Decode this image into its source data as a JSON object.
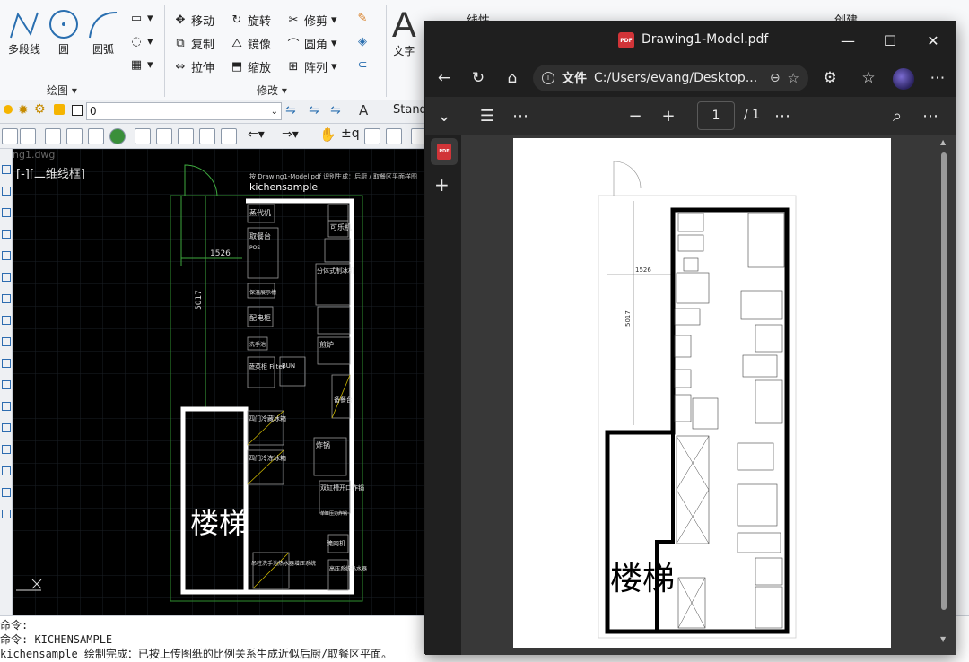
{
  "cad": {
    "ribbon": {
      "draw": {
        "polyline_label": "多段线",
        "circle_label": "圆",
        "arc_label": "圆弧",
        "group_label": "绘图 ▾"
      },
      "modify": {
        "move_label": "移动",
        "rotate_label": "旋转",
        "trim_label": "修剪",
        "copy_label": "复制",
        "mirror_label": "镜像",
        "fillet_label": "圆角",
        "stretch_label": "拉伸",
        "scale_label": "缩放",
        "array_label": "阵列",
        "group_label": "修改 ▾"
      },
      "annotation": {
        "text_label": "文字"
      },
      "partial_right": {
        "linear_label": "线性",
        "create_label": "创建"
      }
    },
    "layer_bar": {
      "layer_value": "0",
      "style_value": "Standa"
    },
    "file_tab": "ng1.dwg",
    "viewport": {
      "view_label": "[-][二维线框]",
      "drawing": {
        "header_note": "按 Drawing1-Model.pdf 识别生成：后厨 / 取餐区平面样图",
        "title": "kichensample",
        "dim_horizontal": "1526",
        "dim_vertical": "5017",
        "stair_label": "楼梯",
        "labels": [
          "蒸代机",
          "可乐机",
          "取餐台",
          "POS",
          "分体式制冰机",
          "保温展示槽",
          "配电柜",
          "洗手池",
          "蔬菜柜 Filter",
          "BUN",
          "四门冷藏冰箱",
          "四门冷冻冰箱",
          "煎炉",
          "炸锅",
          "双缸槽开口炸锅",
          "单缸压力炸锅",
          "腌肉机",
          "高压系统热水器",
          "吊柱洗手池热水器增压系统",
          "备餐台"
        ]
      }
    },
    "command_lines": [
      "命令:",
      "命令: KICHENSAMPLE",
      "kichensample 绘制完成：已按上传图纸的比例关系生成近似后厨/取餐区平面。"
    ]
  },
  "pdf": {
    "window_title": "Drawing1-Model.pdf",
    "address_scheme": "文件",
    "address_path": "C:/Users/evang/Desktop...",
    "current_page": "1",
    "total_pages": "/ 1",
    "stair_label": "楼梯",
    "dim_horizontal": "1526",
    "dim_vertical": "5017"
  },
  "colors": {
    "pdf_chrome": "#1f1f1f",
    "pdf_badge": "#d13438",
    "cad_viewport": "#000000",
    "cad_wall": "#ffffff",
    "cad_dim_line": "#3ea83e"
  }
}
